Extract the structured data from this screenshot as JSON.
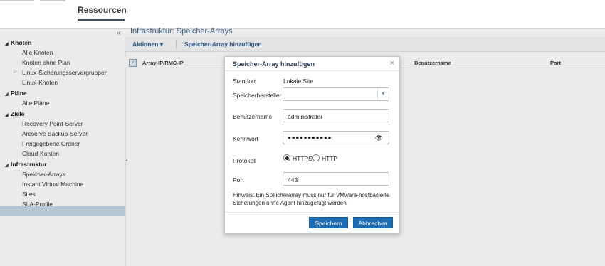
{
  "header": {
    "tab_label": "Ressourcen"
  },
  "sidebar": {
    "collapse_icon": "double-chevron-left-icon",
    "sections": [
      {
        "label": "Knoten",
        "items": [
          "Alle Knoten",
          "Knoten ohne Plan",
          "Linux-Sicherungsservergruppen",
          "Linux-Knoten"
        ]
      },
      {
        "label": "Pläne",
        "items": [
          "Alle Pläne"
        ]
      },
      {
        "label": "Ziele",
        "items": [
          "Recovery Point-Server",
          "Arcserve Backup-Server",
          "Freigegebene Ordner",
          "Cloud-Konten"
        ]
      },
      {
        "label": "Infrastruktur",
        "items": [
          "Speicher-Arrays",
          "Instant Virtual Machine",
          "Sites",
          "SLA-Profile"
        ]
      }
    ],
    "selected_item": "Speicher-Arrays"
  },
  "main": {
    "title": "Infrastruktur: Speicher-Arrays",
    "toolbar": {
      "actions_label": "Aktionen",
      "actions_caret": "▾",
      "add_label": "Speicher-Array hinzufügen"
    },
    "columns": [
      "Array-IP/RMC-IP",
      "Benutzername",
      "Port"
    ],
    "header_checkbox_checked": true
  },
  "dialog": {
    "title": "Speicher-Array hinzufügen",
    "close_icon": "close-icon",
    "location_label": "Standort",
    "location_value": "Lokale Site",
    "vendor_label": "Speicherhersteller",
    "vendor_value": "",
    "username_label": "Benutzername",
    "username_value": "administrator",
    "password_label": "Kennwort",
    "password_value": "●●●●●●●●●●●",
    "protocol_label": "Protokoll",
    "protocol_options": [
      "HTTPS",
      "HTTP"
    ],
    "protocol_selected": "HTTPS",
    "port_label": "Port",
    "port_value": "443",
    "hint": "Hinweis: Ein Speicherarray muss nur für VMware-hostbasierte Sicherungen ohne Agent hinzugefügt werden.",
    "save_label": "Speichern",
    "cancel_label": "Abbrechen"
  },
  "colors": {
    "primary_button": "#1d6cb1",
    "selected_row": "#c6d7e6",
    "title_blue": "#3f6a8c",
    "link_blue": "#2e5c8a"
  }
}
